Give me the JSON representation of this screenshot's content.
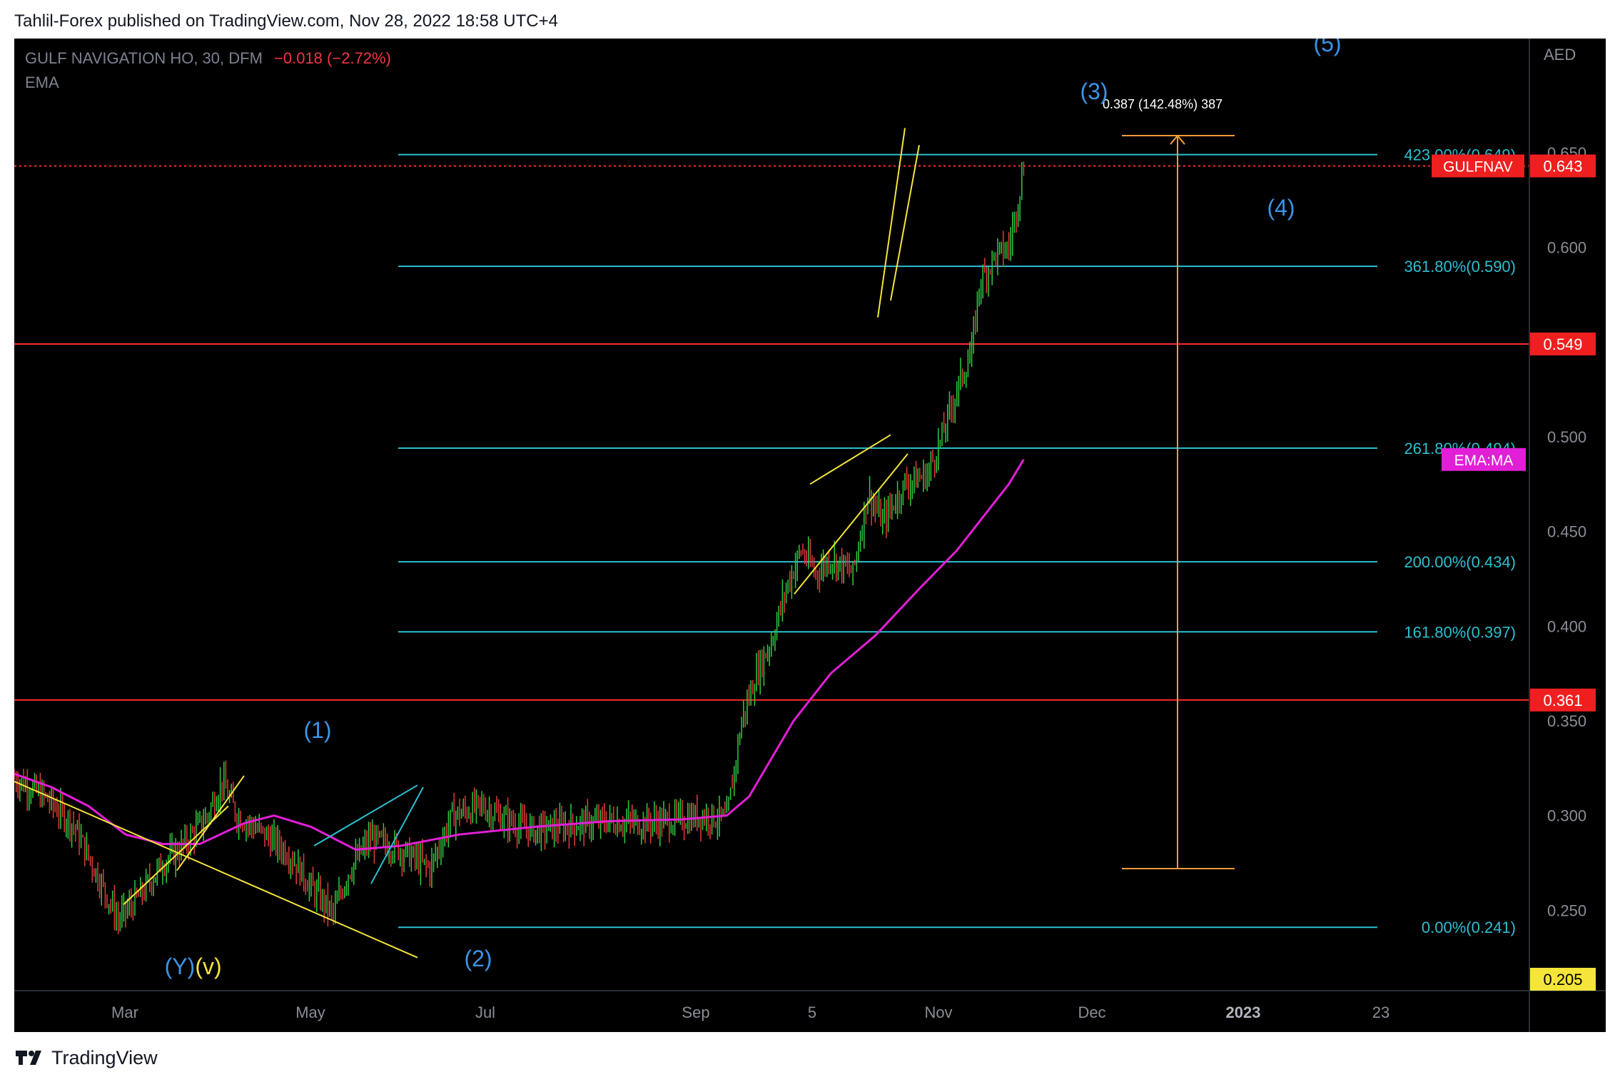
{
  "header": {
    "publisher_line": "Tahlil-Forex published on TradingView.com, Nov 28, 2022 18:58 UTC+4"
  },
  "footer": {
    "brand": "TradingView"
  },
  "colors": {
    "background": "#000000",
    "fib": "#2ebfd1",
    "hline": "#ff2b2b",
    "ema": "#e11fd6",
    "trend": "#f5e43a",
    "measure": "#f59b3a",
    "wave": "#3b94e6",
    "candle_up": "#2ecc40",
    "candle_down": "#e43b3b"
  },
  "chart_data": {
    "type": "candlestick",
    "symbol_line": {
      "name": "GULF NAVIGATION HO, 30, DFM",
      "change": "−0.018 (−2.72%)",
      "indicator": "EMA"
    },
    "price_axis": {
      "currency": "AED",
      "ticks": [
        "0.650",
        "0.600",
        "0.550",
        "0.500",
        "0.450",
        "0.400",
        "0.350",
        "0.300",
        "0.250"
      ],
      "range": [
        0.2,
        0.705
      ]
    },
    "time_axis": {
      "ticks": [
        "Mar",
        "May",
        "Jul",
        "Sep",
        "5",
        "Nov",
        "Dec",
        "2023",
        "23"
      ],
      "bold_tick": "2023"
    },
    "badges": [
      {
        "text": "GULFNAV",
        "value": "0.643",
        "price": 0.643,
        "color": "#f01f1f"
      },
      {
        "text": "",
        "value": "0.549",
        "price": 0.549,
        "color": "#f01f1f"
      },
      {
        "text": "",
        "value": "0.361",
        "price": 0.361,
        "color": "#f01f1f"
      },
      {
        "text": "",
        "value": "0.205",
        "price": 0.205,
        "color": "#f5e43a"
      },
      {
        "text": "EMA:MA",
        "value": "",
        "price": 0.488,
        "color": "#e11fd6"
      }
    ],
    "fib_levels": [
      {
        "label": "423.00%(0.649)",
        "price": 0.649
      },
      {
        "label": "361.80%(0.590)",
        "price": 0.59
      },
      {
        "label": "261.80%(0.494)",
        "price": 0.494
      },
      {
        "label": "200.00%(0.434)",
        "price": 0.434
      },
      {
        "label": "161.80%(0.397)",
        "price": 0.397
      },
      {
        "label": "0.00%(0.241)",
        "price": 0.241
      }
    ],
    "horizontal_lines": [
      0.549,
      0.361
    ],
    "measure": {
      "label": "0.387 (142.48%) 387",
      "from": 0.272,
      "to": 0.659
    },
    "wave_labels": [
      {
        "text": "(1)",
        "color": "#3b94e6"
      },
      {
        "text": "(2)",
        "color": "#3b94e6"
      },
      {
        "text": "(3)",
        "color": "#3b94e6"
      },
      {
        "text": "(4)",
        "color": "#3b94e6"
      },
      {
        "text": "(5)",
        "color": "#3b94e6"
      },
      {
        "text": "(Y)",
        "color": "#3b94e6"
      },
      {
        "text": "(v)",
        "color": "#f5e43a"
      }
    ],
    "close_path": [
      [
        0,
        0.32
      ],
      [
        8,
        0.31
      ],
      [
        16,
        0.295
      ],
      [
        22,
        0.27
      ],
      [
        28,
        0.245
      ],
      [
        34,
        0.258
      ],
      [
        40,
        0.275
      ],
      [
        46,
        0.285
      ],
      [
        52,
        0.3
      ],
      [
        56,
        0.318
      ],
      [
        60,
        0.3
      ],
      [
        66,
        0.292
      ],
      [
        74,
        0.28
      ],
      [
        80,
        0.262
      ],
      [
        86,
        0.248
      ],
      [
        90,
        0.27
      ],
      [
        96,
        0.288
      ],
      [
        104,
        0.282
      ],
      [
        112,
        0.272
      ],
      [
        118,
        0.3
      ],
      [
        126,
        0.305
      ],
      [
        132,
        0.298
      ],
      [
        140,
        0.292
      ],
      [
        150,
        0.295
      ],
      [
        160,
        0.297
      ],
      [
        170,
        0.296
      ],
      [
        180,
        0.298
      ],
      [
        186,
        0.3
      ],
      [
        192,
        0.298
      ],
      [
        196,
        0.35
      ],
      [
        200,
        0.375
      ],
      [
        204,
        0.392
      ],
      [
        208,
        0.42
      ],
      [
        212,
        0.44
      ],
      [
        216,
        0.428
      ],
      [
        220,
        0.436
      ],
      [
        226,
        0.428
      ],
      [
        230,
        0.47
      ],
      [
        234,
        0.455
      ],
      [
        240,
        0.475
      ],
      [
        246,
        0.48
      ],
      [
        250,
        0.5
      ],
      [
        254,
        0.525
      ],
      [
        258,
        0.545
      ],
      [
        260,
        0.58
      ],
      [
        264,
        0.595
      ],
      [
        268,
        0.6
      ],
      [
        270,
        0.62
      ],
      [
        272,
        0.643
      ]
    ],
    "ema_path": [
      [
        0,
        0.322
      ],
      [
        10,
        0.315
      ],
      [
        20,
        0.305
      ],
      [
        30,
        0.29
      ],
      [
        40,
        0.285
      ],
      [
        50,
        0.285
      ],
      [
        62,
        0.296
      ],
      [
        70,
        0.3
      ],
      [
        80,
        0.294
      ],
      [
        92,
        0.282
      ],
      [
        104,
        0.284
      ],
      [
        120,
        0.29
      ],
      [
        140,
        0.294
      ],
      [
        160,
        0.297
      ],
      [
        180,
        0.298
      ],
      [
        192,
        0.3
      ],
      [
        198,
        0.31
      ],
      [
        204,
        0.33
      ],
      [
        210,
        0.35
      ],
      [
        220,
        0.375
      ],
      [
        232,
        0.395
      ],
      [
        244,
        0.42
      ],
      [
        254,
        0.44
      ],
      [
        262,
        0.46
      ],
      [
        268,
        0.475
      ],
      [
        272,
        0.488
      ]
    ]
  }
}
